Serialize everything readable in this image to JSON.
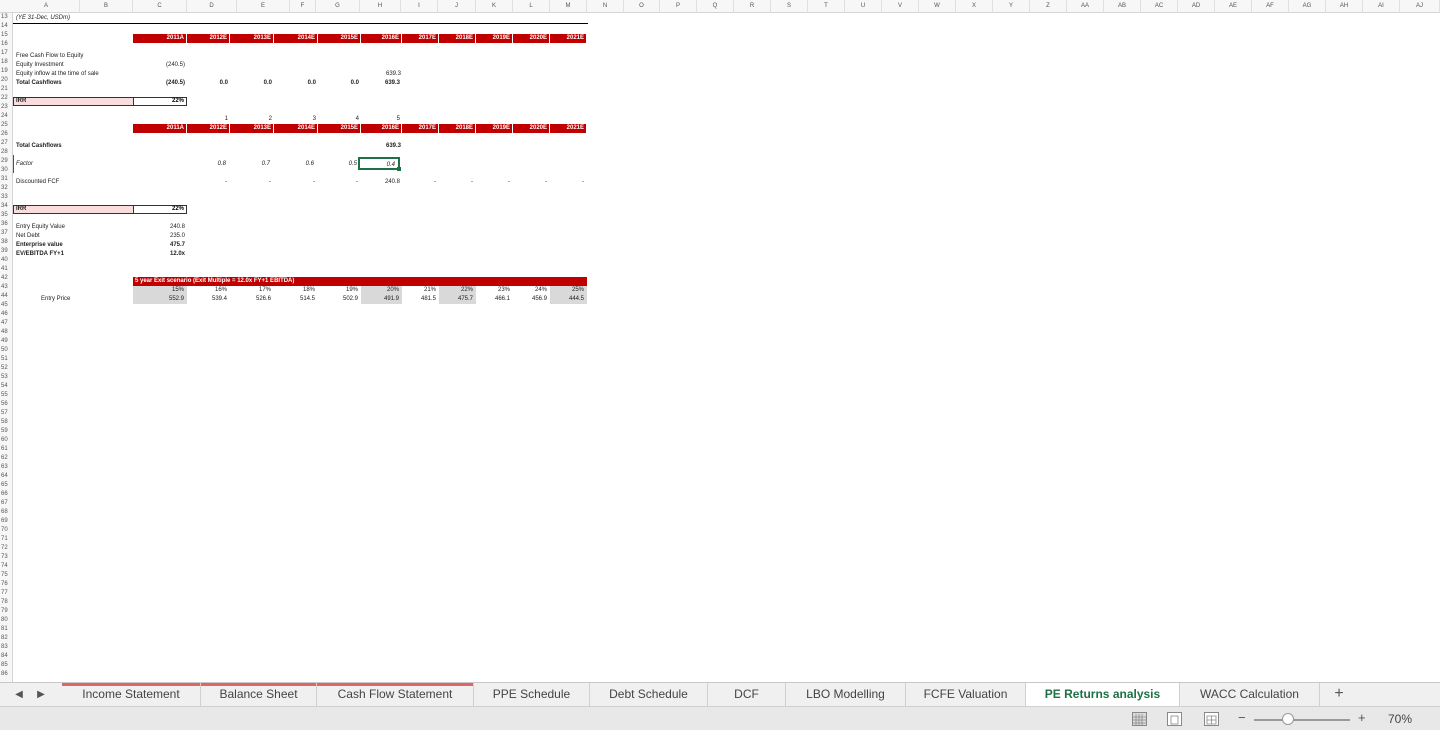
{
  "columns": [
    "A",
    "B",
    "C",
    "D",
    "E",
    "F",
    "G",
    "H",
    "I",
    "J",
    "K",
    "L",
    "M",
    "N",
    "O",
    "P",
    "Q",
    "R",
    "S",
    "T",
    "U",
    "V",
    "W",
    "X",
    "Y",
    "Z",
    "AA",
    "AB",
    "AC",
    "AD",
    "AE",
    "AF",
    "AG",
    "AH",
    "AI",
    "AJ"
  ],
  "rows": [
    "13",
    "14",
    "15",
    "16",
    "17",
    "18",
    "19",
    "20",
    "21",
    "22",
    "23",
    "24",
    "25",
    "26",
    "27",
    "28",
    "29",
    "30",
    "31",
    "32",
    "33",
    "34",
    "35",
    "36",
    "37",
    "38",
    "39",
    "40",
    "41",
    "42",
    "43",
    "44",
    "45",
    "46",
    "47",
    "48",
    "49",
    "50",
    "51",
    "52",
    "53",
    "54",
    "55",
    "56",
    "57",
    "58",
    "59",
    "60",
    "61",
    "62",
    "63",
    "64",
    "65",
    "66",
    "67",
    "68",
    "69",
    "70",
    "71",
    "72",
    "73",
    "74",
    "75",
    "76",
    "77",
    "78",
    "79",
    "80",
    "81",
    "82",
    "83",
    "84",
    "85",
    "86"
  ],
  "sheet": {
    "period_note": "(YE 31-Dec, USDm)",
    "years": [
      "2011A",
      "2012E",
      "2013E",
      "2014E",
      "2015E",
      "2016E",
      "2017E",
      "2018E",
      "2019E",
      "2020E",
      "2021E"
    ],
    "fcf_section": {
      "header": "Free Cash Flow to Equity",
      "equity_investment_label": "Equity Investment",
      "equity_investment_value": "(240.5)",
      "equity_inflow_label": "Equity inflow at the time of sale",
      "equity_inflow_value": "639.3",
      "total_label": "Total Cashflows",
      "total_values": [
        "(240.5)",
        "0.0",
        "0.0",
        "0.0",
        "0.0",
        "639.3"
      ]
    },
    "irr_label": "IRR",
    "irr_value": "22%",
    "periods": [
      "1",
      "2",
      "3",
      "4",
      "5"
    ],
    "discount_section": {
      "total_label": "Total Cashflows",
      "total_value": "639.3",
      "factor_label": "Factor",
      "factor_values": [
        "0.8",
        "0.7",
        "0.6",
        "0.5",
        "0.4"
      ],
      "dfcf_label": "Discounted FCF",
      "dfcf_dashes": [
        "-",
        "-",
        "-",
        "-",
        "-",
        "-",
        "-",
        "-",
        "-"
      ],
      "dfcf_value": "240.8"
    },
    "irr2_label": "IRR",
    "irr2_value": "22%",
    "entry_section": {
      "entry_equity_label": "Entry Equity Value",
      "entry_equity_value": "240.8",
      "net_debt_label": "Net Debt",
      "net_debt_value": "235.0",
      "ev_label": "Enterprise value",
      "ev_value": "475.7",
      "multiple_label": "EV/EBITDA FY+1",
      "multiple_value": "12.0x"
    },
    "scenario": {
      "title": "5 year Exit scenario (Exit Multiple = 12.0x FY+1 EBITDA)",
      "row_label": "Entry Price",
      "irrs": [
        "15%",
        "16%",
        "17%",
        "18%",
        "19%",
        "20%",
        "21%",
        "22%",
        "23%",
        "24%",
        "25%"
      ],
      "prices": [
        "552.9",
        "539.4",
        "526.6",
        "514.5",
        "502.9",
        "491.9",
        "481.5",
        "475.7",
        "466.1",
        "456.9",
        "444.5"
      ]
    }
  },
  "tabs": [
    "Income Statement",
    "Balance Sheet",
    "Cash Flow Statement",
    "PPE Schedule",
    "Debt Schedule",
    "DCF",
    "LBO Modelling",
    "FCFE Valuation",
    "PE Returns analysis",
    "WACC Calculation"
  ],
  "add_tab": "+",
  "zoom": {
    "minus": "−",
    "plus": "+",
    "label": "70%",
    "percent": 70
  },
  "colors": {
    "header_red": "#c00000",
    "accent_green": "#1e7145",
    "irr_pink": "#f9dcdc",
    "tab_red": "#e06666"
  }
}
